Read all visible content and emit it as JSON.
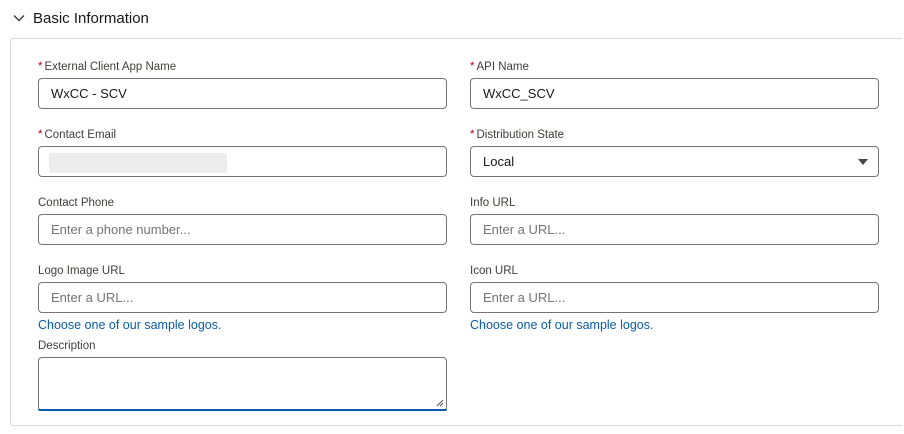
{
  "section": {
    "title": "Basic Information"
  },
  "form": {
    "app_name": {
      "label": "External Client App Name",
      "value": "WxCC - SCV"
    },
    "api_name": {
      "label": "API Name",
      "value": "WxCC_SCV"
    },
    "contact_email": {
      "label": "Contact Email"
    },
    "distribution_state": {
      "label": "Distribution State",
      "value": "Local"
    },
    "contact_phone": {
      "label": "Contact Phone",
      "placeholder": "Enter a phone number..."
    },
    "info_url": {
      "label": "Info URL",
      "placeholder": "Enter a URL..."
    },
    "logo_image_url": {
      "label": "Logo Image URL",
      "placeholder": "Enter a URL...",
      "link": "Choose one of our sample logos."
    },
    "icon_url": {
      "label": "Icon URL",
      "placeholder": "Enter a URL...",
      "link": "Choose one of our sample logos."
    },
    "description": {
      "label": "Description"
    },
    "required_marker": "*"
  },
  "colors": {
    "required": "#ba0517",
    "link": "#0b5cab",
    "border": "#747474"
  },
  "icons": {
    "section_toggle": "chevron-down-icon",
    "select": "caret-down-icon",
    "resize": "resize-grip-icon"
  }
}
